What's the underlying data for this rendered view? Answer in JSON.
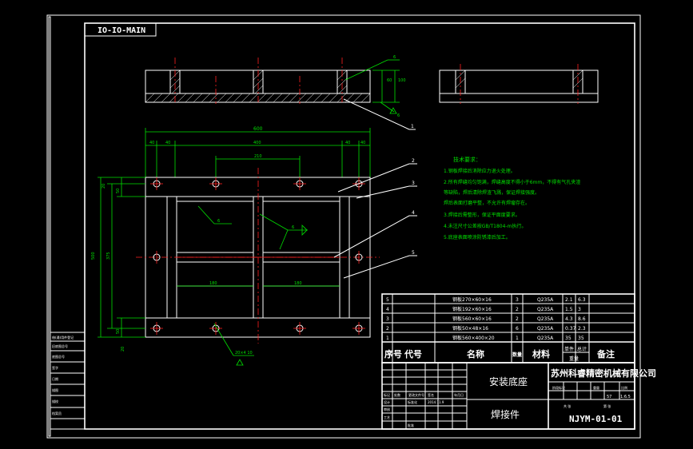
{
  "header_tag": "IO-IO-MAIN",
  "views": {
    "front_dims": {
      "dim_total": "600",
      "dim_inner": "400",
      "dim_210": "210",
      "dim_40a": "40",
      "dim_40b": "40",
      "dim_40c": "40",
      "dim_40d": "40"
    },
    "side_dims": {
      "left": "500",
      "mid": "375",
      "a": "50",
      "b": "50",
      "c": "20",
      "d": "20"
    },
    "mid_dims": {
      "a": "180",
      "b": "180"
    },
    "top_dims": {
      "h": "60",
      "h2": "100"
    },
    "weld_labels": {
      "w1": "6",
      "w2": "6",
      "w3": "6",
      "w4": "6"
    },
    "bottom_note": "20×4 10",
    "leader_numbers": [
      "1",
      "2",
      "3",
      "4",
      "5"
    ]
  },
  "tech_requirements": {
    "title": "技术要求：",
    "items": [
      "1.钢板焊接后消除应力退火处理。",
      "2.所有焊缝均匀饱满，焊缝高度不得小于6mm，不得有气孔夹渣",
      "   等缺陷，焊后清除焊渣飞溅，保证焊接强度。",
      "   焊后表面打磨平整，不允许有焊瘤存在。",
      "3.焊接后需整形，保证平面度要求。",
      "4.未注尺寸公差按GB/T1804-m执行。",
      "5.底座表面喷涂防锈漆后加工。"
    ]
  },
  "parts_list": {
    "rows": [
      {
        "no": "5",
        "name": "钢板270×60×16",
        "qty": "3",
        "material": "Q235A",
        "unit": "2.1",
        "total": "6.3"
      },
      {
        "no": "4",
        "name": "钢板192×60×16",
        "qty": "2",
        "material": "Q235A",
        "unit": "1.5",
        "total": "3"
      },
      {
        "no": "3",
        "name": "钢板560×60×16",
        "qty": "2",
        "material": "Q235A",
        "unit": "4.3",
        "total": "8.6"
      },
      {
        "no": "2",
        "name": "钢板50×48×16",
        "qty": "6",
        "material": "Q235A",
        "unit": "0.37",
        "total": "2.3"
      },
      {
        "no": "1",
        "name": "钢板560×400×20",
        "qty": "1",
        "material": "Q235A",
        "unit": "35",
        "total": "35"
      }
    ],
    "headers": {
      "no": "序号",
      "code": "代号",
      "name": "名称",
      "qty": "数量",
      "material": "材料",
      "single": "单件",
      "total": "总计",
      "weight": "重量",
      "remark": "备注"
    }
  },
  "title_block": {
    "drawing_name": "安装底座",
    "part_type": "焊接件",
    "company": "苏州科睿精密机械有限公司",
    "drawing_number": "NJYM-01-01",
    "scale_label": "比例",
    "scale_value": "1:6.5",
    "weight_label": "重量",
    "weight_value": "57",
    "stage_label": "阶段标记",
    "sheet_label": "共  张",
    "sheet2_label": "第  张",
    "designer_label": "设计",
    "std_label": "标准化",
    "date_value": "2014.11.9",
    "process_label": "工艺",
    "approve_label": "批准",
    "review_label": "审核",
    "mark_labels": [
      "标记",
      "处数",
      "分区",
      "更改文件号",
      "签名",
      "年月日"
    ]
  },
  "left_strip": [
    "借(通)用件登记",
    "旧底图总号",
    "底图总号",
    "签字",
    "日期",
    "描图",
    "描校",
    "档案员"
  ]
}
